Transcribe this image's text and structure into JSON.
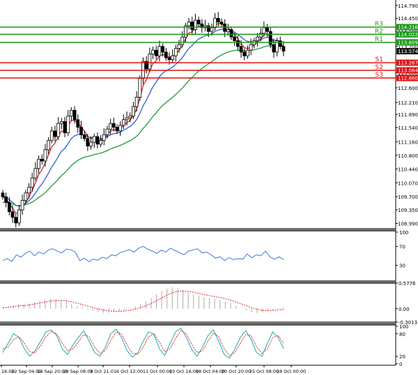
{
  "chart_data": [
    {
      "type": "candlestick",
      "panel": "price",
      "ylim": [
        108.85,
        114.9
      ],
      "y_ticks": [
        114.79,
        114.45,
        114.1,
        113.7,
        113.0,
        112.6,
        112.21,
        111.89,
        111.54,
        111.16,
        110.8,
        110.44,
        110.07,
        109.7,
        109.35,
        108.99
      ],
      "x_tick_labels": [
        "16:00",
        "22 Sep 04:00",
        "24 Sep 20:00",
        "29 Sep 08:00",
        "3 Oct 21:01",
        "6 Oct 12:00",
        "11 Oct 00:00",
        "13 Oct 16:00",
        "18 Oct 04:00",
        "20 Oct 20:00",
        "25 Oct 08:00",
        "28 Oct 00:00"
      ],
      "current_price": 113.574,
      "levels": [
        {
          "name": "R3",
          "value": 114.216,
          "color": "#1a9a1a"
        },
        {
          "name": "R2",
          "value": 114.022,
          "color": "#1a9a1a"
        },
        {
          "name": "R1",
          "value": 113.809,
          "color": "#1a9a1a"
        },
        {
          "name": "S1",
          "value": 113.267,
          "color": "#dd1111"
        },
        {
          "name": "S2",
          "value": 113.064,
          "color": "#dd1111"
        },
        {
          "name": "S3",
          "value": 112.86,
          "color": "#dd1111"
        }
      ],
      "level_price_labels": [
        "114.216",
        "114.022",
        "113.809",
        "113.574",
        "113.267",
        "113.064",
        "112.860"
      ],
      "close_series": [
        109.7,
        109.55,
        109.3,
        109.15,
        109.0,
        109.35,
        109.6,
        109.8,
        109.95,
        110.2,
        110.45,
        110.7,
        110.65,
        110.95,
        111.2,
        111.45,
        111.3,
        111.65,
        111.7,
        111.4,
        111.85,
        112.0,
        111.75,
        111.55,
        111.35,
        111.25,
        111.05,
        111.15,
        111.3,
        111.1,
        111.2,
        111.35,
        111.5,
        111.65,
        111.55,
        111.45,
        111.6,
        111.75,
        111.8,
        111.85,
        112.1,
        112.35,
        112.85,
        113.3,
        113.1,
        113.5,
        113.6,
        113.45,
        113.7,
        113.55,
        113.4,
        113.35,
        113.45,
        113.65,
        113.75,
        113.95,
        114.25,
        114.35,
        114.15,
        114.4,
        114.3,
        114.2,
        114.25,
        114.1,
        114.2,
        114.45,
        114.35,
        114.3,
        114.1,
        114.15,
        113.95,
        113.85,
        113.7,
        113.55,
        113.45,
        113.6,
        113.75,
        113.85,
        113.95,
        114.05,
        114.2,
        114.1,
        113.75,
        113.55,
        113.85,
        113.7,
        113.574
      ],
      "moving_averages": [
        {
          "color": "#dd2222"
        },
        {
          "color": "#2a5fd8"
        },
        {
          "color": "#1d9a3a"
        }
      ]
    },
    {
      "type": "line",
      "panel": "rsi",
      "ylim": [
        0,
        100
      ],
      "y_ticks": [
        100,
        70,
        30
      ],
      "series": [
        {
          "color": "#3a78d8",
          "values": [
            40,
            44,
            38,
            52,
            47,
            55,
            60,
            50,
            58,
            54,
            62,
            65,
            60,
            56,
            64,
            63,
            58,
            40,
            45,
            38,
            43,
            41,
            47,
            44,
            52,
            50,
            57,
            60,
            63,
            58,
            66,
            70,
            64,
            60,
            55,
            62,
            58,
            66,
            61,
            57,
            52,
            60,
            62,
            65,
            56,
            58,
            52,
            45,
            48,
            40,
            46,
            42,
            44,
            43,
            54,
            46,
            52,
            50,
            60,
            48,
            43,
            48,
            42
          ]
        }
      ]
    },
    {
      "type": "line",
      "panel": "macd",
      "y_ticks": [
        "0.5776",
        "0.00",
        "-0.3013"
      ],
      "ylim": [
        -0.3013,
        0.5776
      ],
      "histogram": [
        0.02,
        0.05,
        0.08,
        0.1,
        0.09,
        0.12,
        0.15,
        0.18,
        0.2,
        0.22,
        0.21,
        0.19,
        0.16,
        0.1,
        0.05,
        0.02,
        -0.02,
        -0.05,
        -0.08,
        -0.09,
        -0.1,
        -0.08,
        -0.06,
        -0.03,
        0.0,
        0.05,
        0.1,
        0.16,
        0.24,
        0.32,
        0.4,
        0.45,
        0.48,
        0.46,
        0.42,
        0.37,
        0.32,
        0.28,
        0.26,
        0.24,
        0.22,
        0.2,
        0.16,
        0.12,
        0.06,
        0.0,
        -0.04,
        -0.08,
        -0.1,
        -0.09,
        -0.06,
        -0.03,
        -0.01,
        0.02
      ],
      "signal_color": "#dd2222",
      "histogram_color": "#aaaaaa"
    },
    {
      "type": "line",
      "panel": "stochastic",
      "ylim": [
        0,
        100
      ],
      "y_ticks": [
        100,
        80,
        20,
        0
      ],
      "series": [
        {
          "color": "#22a8b8",
          "values": [
            30,
            55,
            80,
            70,
            40,
            20,
            35,
            60,
            85,
            90,
            75,
            40,
            25,
            50,
            70,
            88,
            60,
            30,
            20,
            45,
            80,
            92,
            70,
            35,
            18,
            30,
            60,
            85,
            78,
            40,
            22,
            55,
            85,
            95,
            70,
            38,
            20,
            45,
            75,
            90,
            60,
            25,
            15,
            40,
            70,
            88,
            65,
            30,
            20,
            55,
            85,
            70,
            40
          ]
        },
        {
          "color": "#dd2222",
          "values": [
            40,
            45,
            65,
            72,
            55,
            32,
            30,
            48,
            72,
            86,
            80,
            55,
            35,
            40,
            58,
            78,
            72,
            45,
            28,
            35,
            62,
            85,
            80,
            50,
            28,
            25,
            45,
            72,
            80,
            58,
            32,
            40,
            68,
            88,
            80,
            52,
            30,
            35,
            60,
            82,
            72,
            40,
            22,
            30,
            55,
            78,
            75,
            45,
            28,
            40,
            70,
            75,
            55
          ]
        }
      ]
    }
  ]
}
